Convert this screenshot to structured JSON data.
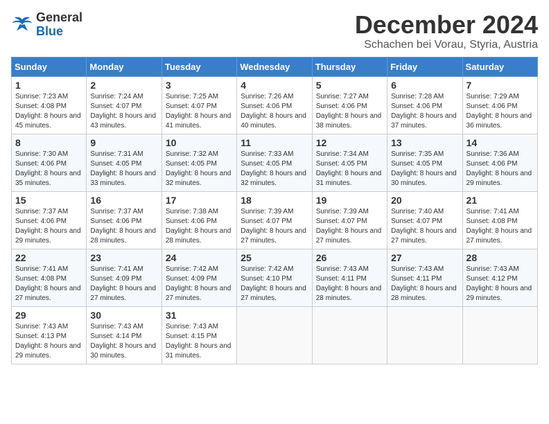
{
  "logo": {
    "line1": "General",
    "line2": "Blue"
  },
  "title": "December 2024",
  "subtitle": "Schachen bei Vorau, Styria, Austria",
  "headers": [
    "Sunday",
    "Monday",
    "Tuesday",
    "Wednesday",
    "Thursday",
    "Friday",
    "Saturday"
  ],
  "weeks": [
    [
      {
        "day": "1",
        "sunrise": "7:23 AM",
        "sunset": "4:08 PM",
        "daylight": "8 hours and 45 minutes."
      },
      {
        "day": "2",
        "sunrise": "7:24 AM",
        "sunset": "4:07 PM",
        "daylight": "8 hours and 43 minutes."
      },
      {
        "day": "3",
        "sunrise": "7:25 AM",
        "sunset": "4:07 PM",
        "daylight": "8 hours and 41 minutes."
      },
      {
        "day": "4",
        "sunrise": "7:26 AM",
        "sunset": "4:06 PM",
        "daylight": "8 hours and 40 minutes."
      },
      {
        "day": "5",
        "sunrise": "7:27 AM",
        "sunset": "4:06 PM",
        "daylight": "8 hours and 38 minutes."
      },
      {
        "day": "6",
        "sunrise": "7:28 AM",
        "sunset": "4:06 PM",
        "daylight": "8 hours and 37 minutes."
      },
      {
        "day": "7",
        "sunrise": "7:29 AM",
        "sunset": "4:06 PM",
        "daylight": "8 hours and 36 minutes."
      }
    ],
    [
      {
        "day": "8",
        "sunrise": "7:30 AM",
        "sunset": "4:06 PM",
        "daylight": "8 hours and 35 minutes."
      },
      {
        "day": "9",
        "sunrise": "7:31 AM",
        "sunset": "4:05 PM",
        "daylight": "8 hours and 33 minutes."
      },
      {
        "day": "10",
        "sunrise": "7:32 AM",
        "sunset": "4:05 PM",
        "daylight": "8 hours and 32 minutes."
      },
      {
        "day": "11",
        "sunrise": "7:33 AM",
        "sunset": "4:05 PM",
        "daylight": "8 hours and 32 minutes."
      },
      {
        "day": "12",
        "sunrise": "7:34 AM",
        "sunset": "4:05 PM",
        "daylight": "8 hours and 31 minutes."
      },
      {
        "day": "13",
        "sunrise": "7:35 AM",
        "sunset": "4:05 PM",
        "daylight": "8 hours and 30 minutes."
      },
      {
        "day": "14",
        "sunrise": "7:36 AM",
        "sunset": "4:06 PM",
        "daylight": "8 hours and 29 minutes."
      }
    ],
    [
      {
        "day": "15",
        "sunrise": "7:37 AM",
        "sunset": "4:06 PM",
        "daylight": "8 hours and 29 minutes."
      },
      {
        "day": "16",
        "sunrise": "7:37 AM",
        "sunset": "4:06 PM",
        "daylight": "8 hours and 28 minutes."
      },
      {
        "day": "17",
        "sunrise": "7:38 AM",
        "sunset": "4:06 PM",
        "daylight": "8 hours and 28 minutes."
      },
      {
        "day": "18",
        "sunrise": "7:39 AM",
        "sunset": "4:07 PM",
        "daylight": "8 hours and 27 minutes."
      },
      {
        "day": "19",
        "sunrise": "7:39 AM",
        "sunset": "4:07 PM",
        "daylight": "8 hours and 27 minutes."
      },
      {
        "day": "20",
        "sunrise": "7:40 AM",
        "sunset": "4:07 PM",
        "daylight": "8 hours and 27 minutes."
      },
      {
        "day": "21",
        "sunrise": "7:41 AM",
        "sunset": "4:08 PM",
        "daylight": "8 hours and 27 minutes."
      }
    ],
    [
      {
        "day": "22",
        "sunrise": "7:41 AM",
        "sunset": "4:08 PM",
        "daylight": "8 hours and 27 minutes."
      },
      {
        "day": "23",
        "sunrise": "7:41 AM",
        "sunset": "4:09 PM",
        "daylight": "8 hours and 27 minutes."
      },
      {
        "day": "24",
        "sunrise": "7:42 AM",
        "sunset": "4:09 PM",
        "daylight": "8 hours and 27 minutes."
      },
      {
        "day": "25",
        "sunrise": "7:42 AM",
        "sunset": "4:10 PM",
        "daylight": "8 hours and 27 minutes."
      },
      {
        "day": "26",
        "sunrise": "7:43 AM",
        "sunset": "4:11 PM",
        "daylight": "8 hours and 28 minutes."
      },
      {
        "day": "27",
        "sunrise": "7:43 AM",
        "sunset": "4:11 PM",
        "daylight": "8 hours and 28 minutes."
      },
      {
        "day": "28",
        "sunrise": "7:43 AM",
        "sunset": "4:12 PM",
        "daylight": "8 hours and 29 minutes."
      }
    ],
    [
      {
        "day": "29",
        "sunrise": "7:43 AM",
        "sunset": "4:13 PM",
        "daylight": "8 hours and 29 minutes."
      },
      {
        "day": "30",
        "sunrise": "7:43 AM",
        "sunset": "4:14 PM",
        "daylight": "8 hours and 30 minutes."
      },
      {
        "day": "31",
        "sunrise": "7:43 AM",
        "sunset": "4:15 PM",
        "daylight": "8 hours and 31 minutes."
      },
      null,
      null,
      null,
      null
    ]
  ],
  "labels": {
    "sunrise": "Sunrise:",
    "sunset": "Sunset:",
    "daylight": "Daylight:"
  }
}
